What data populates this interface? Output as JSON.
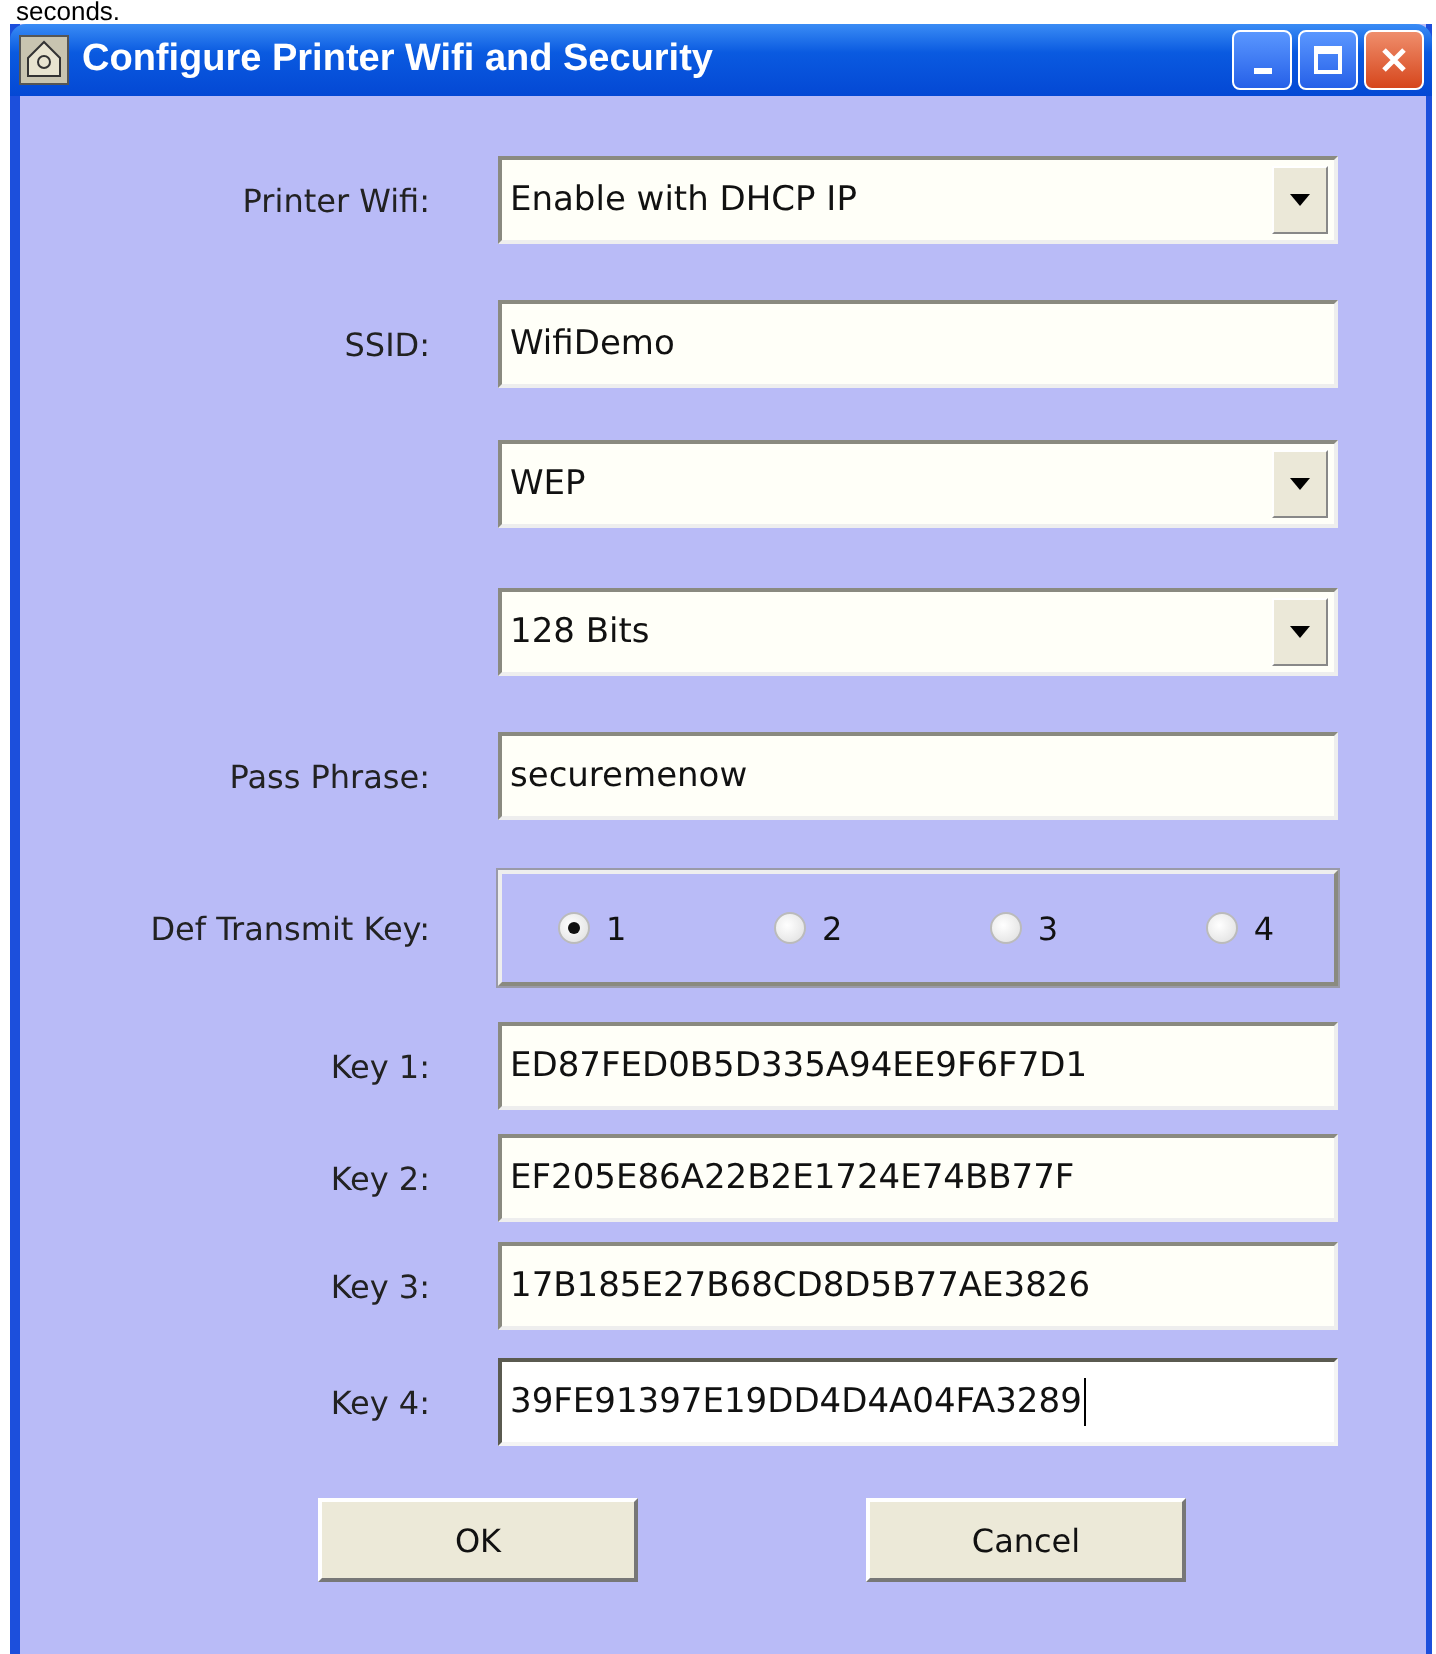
{
  "caption_above": "seconds.",
  "window": {
    "title": "Configure Printer Wifi and Security"
  },
  "form": {
    "rows": [
      {
        "kind": "dropdown",
        "label": "Printer Wifi:",
        "value": "Enable with DHCP IP"
      },
      {
        "kind": "text",
        "label": "SSID:",
        "value": "WifiDemo",
        "focused": false
      },
      {
        "kind": "dropdown",
        "value": "WEP"
      },
      {
        "kind": "dropdown",
        "value": "128 Bits"
      },
      {
        "kind": "text",
        "label": "Pass Phrase:",
        "value": "securemenow",
        "focused": false
      },
      {
        "kind": "radio",
        "label": "Def Transmit Key:",
        "options": [
          {
            "label": "1",
            "selected": true
          },
          {
            "label": "2",
            "selected": false
          },
          {
            "label": "3",
            "selected": false
          },
          {
            "label": "4",
            "selected": false
          }
        ]
      },
      {
        "kind": "key",
        "label": "Key 1:",
        "value": "ED87FED0B5D335A94EE9F6F7D1",
        "focused": false
      },
      {
        "kind": "key",
        "label": "Key 2:",
        "value": "EF205E86A22B2E1724E74BB77F",
        "focused": false
      },
      {
        "kind": "key",
        "label": "Key 3:",
        "value": "17B185E27B68CD8D5B77AE3826",
        "focused": false
      },
      {
        "kind": "key",
        "label": "Key 4:",
        "value": "39FE91397E19DD4D4A04FA3289",
        "focused": true
      }
    ]
  },
  "buttons": [
    "OK",
    "Cancel"
  ]
}
